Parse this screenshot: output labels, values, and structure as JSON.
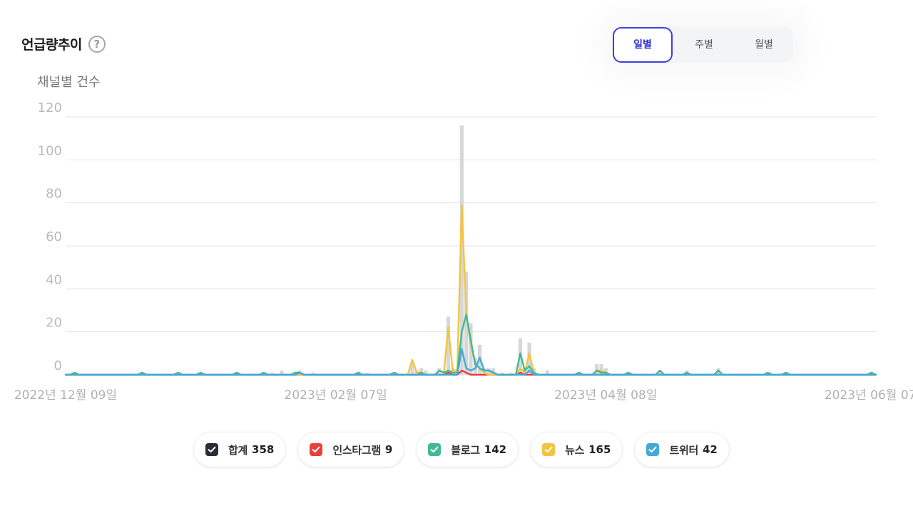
{
  "header": {
    "title": "언급량추이",
    "help_icon": "question-circle-icon"
  },
  "period_toggle": {
    "options": [
      "일별",
      "주별",
      "월별"
    ],
    "selected": "일별",
    "accent": "#3d3ee0"
  },
  "chart_data": {
    "type": "bar+line",
    "ylabel": "채널별 건수",
    "ylim": [
      0,
      120
    ],
    "yticks": [
      0,
      20,
      40,
      60,
      80,
      100,
      120
    ],
    "xlim": [
      "2022-12-09",
      "2023-06-07"
    ],
    "xtick_labels": [
      {
        "date": "2022-12-09",
        "label": "2022년 12월 09일"
      },
      {
        "date": "2023-02-07",
        "label": "2023년 02월 07일"
      },
      {
        "date": "2023-04-08",
        "label": "2023년 04월 08일"
      },
      {
        "date": "2023-06-07",
        "label": "2023년 06월 07일"
      }
    ],
    "grid": true,
    "bar_series": {
      "name": "합계",
      "color": "#d6d7db",
      "points": [
        [
          "2022-12-11",
          1
        ],
        [
          "2022-12-26",
          1
        ],
        [
          "2023-01-03",
          1
        ],
        [
          "2023-01-08",
          1
        ],
        [
          "2023-01-16",
          1
        ],
        [
          "2023-01-22",
          1
        ],
        [
          "2023-01-24",
          1
        ],
        [
          "2023-01-26",
          2
        ],
        [
          "2023-01-29",
          1
        ],
        [
          "2023-01-30",
          2
        ],
        [
          "2023-02-02",
          1
        ],
        [
          "2023-02-12",
          1
        ],
        [
          "2023-02-14",
          1
        ],
        [
          "2023-02-20",
          1
        ],
        [
          "2023-02-24",
          6
        ],
        [
          "2023-02-25",
          2
        ],
        [
          "2023-02-26",
          3
        ],
        [
          "2023-02-27",
          2
        ],
        [
          "2023-03-02",
          3
        ],
        [
          "2023-03-04",
          27
        ],
        [
          "2023-03-05",
          3
        ],
        [
          "2023-03-07",
          116
        ],
        [
          "2023-03-08",
          48
        ],
        [
          "2023-03-09",
          24
        ],
        [
          "2023-03-10",
          8
        ],
        [
          "2023-03-11",
          14
        ],
        [
          "2023-03-12",
          3
        ],
        [
          "2023-03-13",
          3
        ],
        [
          "2023-03-14",
          3
        ],
        [
          "2023-03-16",
          1
        ],
        [
          "2023-03-18",
          1
        ],
        [
          "2023-03-20",
          17
        ],
        [
          "2023-03-21",
          3
        ],
        [
          "2023-03-22",
          15
        ],
        [
          "2023-03-23",
          3
        ],
        [
          "2023-03-26",
          2
        ],
        [
          "2023-04-02",
          1
        ],
        [
          "2023-04-06",
          5
        ],
        [
          "2023-04-07",
          5
        ],
        [
          "2023-04-08",
          3
        ],
        [
          "2023-04-13",
          1
        ],
        [
          "2023-04-20",
          2
        ],
        [
          "2023-04-26",
          2
        ],
        [
          "2023-05-03",
          3
        ],
        [
          "2023-05-14",
          1
        ],
        [
          "2023-05-18",
          1
        ],
        [
          "2023-06-06",
          1
        ]
      ]
    },
    "line_series": [
      {
        "name": "인스타그램",
        "color": "#e8413a",
        "points": [
          [
            "2023-03-03",
            0
          ],
          [
            "2023-03-04",
            1
          ],
          [
            "2023-03-05",
            0
          ],
          [
            "2023-03-06",
            0
          ],
          [
            "2023-03-07",
            2
          ],
          [
            "2023-03-08",
            1
          ],
          [
            "2023-03-09",
            0
          ],
          [
            "2023-03-19",
            0
          ],
          [
            "2023-03-20",
            1
          ],
          [
            "2023-03-21",
            0
          ]
        ]
      },
      {
        "name": "뉴스",
        "color": "#f3c43f",
        "points": [
          [
            "2023-02-23",
            0
          ],
          [
            "2023-02-24",
            7
          ],
          [
            "2023-02-25",
            1
          ],
          [
            "2023-02-26",
            1
          ],
          [
            "2023-02-27",
            0
          ],
          [
            "2023-03-03",
            0
          ],
          [
            "2023-03-04",
            22
          ],
          [
            "2023-03-05",
            2
          ],
          [
            "2023-03-06",
            2
          ],
          [
            "2023-03-07",
            79
          ],
          [
            "2023-03-08",
            28
          ],
          [
            "2023-03-09",
            14
          ],
          [
            "2023-03-10",
            5
          ],
          [
            "2023-03-11",
            3
          ],
          [
            "2023-03-12",
            1
          ],
          [
            "2023-03-13",
            0
          ],
          [
            "2023-03-19",
            0
          ],
          [
            "2023-03-20",
            3
          ],
          [
            "2023-03-21",
            1
          ],
          [
            "2023-03-22",
            10
          ],
          [
            "2023-03-23",
            1
          ],
          [
            "2023-03-24",
            0
          ],
          [
            "2023-04-05",
            0
          ],
          [
            "2023-04-06",
            2
          ],
          [
            "2023-04-07",
            2
          ],
          [
            "2023-04-08",
            1
          ],
          [
            "2023-04-09",
            0
          ]
        ]
      },
      {
        "name": "블로그",
        "color": "#43b894",
        "points": [
          [
            "2022-12-10",
            0
          ],
          [
            "2022-12-11",
            1
          ],
          [
            "2022-12-12",
            0
          ],
          [
            "2022-12-25",
            0
          ],
          [
            "2022-12-26",
            1
          ],
          [
            "2022-12-27",
            0
          ],
          [
            "2023-01-02",
            0
          ],
          [
            "2023-01-03",
            1
          ],
          [
            "2023-01-04",
            0
          ],
          [
            "2023-01-07",
            0
          ],
          [
            "2023-01-08",
            1
          ],
          [
            "2023-01-09",
            0
          ],
          [
            "2023-01-15",
            0
          ],
          [
            "2023-01-16",
            1
          ],
          [
            "2023-01-17",
            0
          ],
          [
            "2023-01-21",
            0
          ],
          [
            "2023-01-22",
            1
          ],
          [
            "2023-01-23",
            0
          ],
          [
            "2023-01-28",
            0
          ],
          [
            "2023-01-29",
            1
          ],
          [
            "2023-01-30",
            1
          ],
          [
            "2023-01-31",
            0
          ],
          [
            "2023-02-11",
            0
          ],
          [
            "2023-02-12",
            1
          ],
          [
            "2023-02-13",
            0
          ],
          [
            "2023-02-19",
            0
          ],
          [
            "2023-02-20",
            1
          ],
          [
            "2023-02-21",
            0
          ],
          [
            "2023-02-25",
            0
          ],
          [
            "2023-02-26",
            1
          ],
          [
            "2023-02-27",
            0
          ],
          [
            "2023-03-01",
            0
          ],
          [
            "2023-03-02",
            2
          ],
          [
            "2023-03-03",
            1
          ],
          [
            "2023-03-04",
            2
          ],
          [
            "2023-03-05",
            1
          ],
          [
            "2023-03-06",
            1
          ],
          [
            "2023-03-07",
            20
          ],
          [
            "2023-03-08",
            28
          ],
          [
            "2023-03-09",
            16
          ],
          [
            "2023-03-10",
            5
          ],
          [
            "2023-03-11",
            3
          ],
          [
            "2023-03-12",
            2
          ],
          [
            "2023-03-13",
            2
          ],
          [
            "2023-03-14",
            1
          ],
          [
            "2023-03-15",
            0
          ],
          [
            "2023-03-19",
            0
          ],
          [
            "2023-03-20",
            10
          ],
          [
            "2023-03-21",
            2
          ],
          [
            "2023-03-22",
            4
          ],
          [
            "2023-03-23",
            1
          ],
          [
            "2023-03-24",
            0
          ],
          [
            "2023-04-01",
            0
          ],
          [
            "2023-04-02",
            1
          ],
          [
            "2023-04-03",
            0
          ],
          [
            "2023-04-05",
            0
          ],
          [
            "2023-04-06",
            2
          ],
          [
            "2023-04-07",
            1
          ],
          [
            "2023-04-08",
            1
          ],
          [
            "2023-04-09",
            0
          ],
          [
            "2023-04-12",
            0
          ],
          [
            "2023-04-13",
            1
          ],
          [
            "2023-04-14",
            0
          ],
          [
            "2023-04-19",
            0
          ],
          [
            "2023-04-20",
            2
          ],
          [
            "2023-04-21",
            0
          ],
          [
            "2023-04-25",
            0
          ],
          [
            "2023-04-26",
            1
          ],
          [
            "2023-04-27",
            0
          ],
          [
            "2023-05-02",
            0
          ],
          [
            "2023-05-03",
            2
          ],
          [
            "2023-05-04",
            0
          ],
          [
            "2023-05-13",
            0
          ],
          [
            "2023-05-14",
            1
          ],
          [
            "2023-05-15",
            0
          ],
          [
            "2023-05-17",
            0
          ],
          [
            "2023-05-18",
            1
          ],
          [
            "2023-05-19",
            0
          ],
          [
            "2023-06-05",
            0
          ],
          [
            "2023-06-06",
            1
          ],
          [
            "2023-06-07",
            0
          ]
        ]
      },
      {
        "name": "트위터",
        "color": "#45a9d6",
        "points": [
          [
            "2023-01-29",
            0
          ],
          [
            "2023-01-30",
            1
          ],
          [
            "2023-01-31",
            0
          ],
          [
            "2023-03-06",
            0
          ],
          [
            "2023-03-07",
            12
          ],
          [
            "2023-03-08",
            3
          ],
          [
            "2023-03-09",
            2
          ],
          [
            "2023-03-10",
            3
          ],
          [
            "2023-03-11",
            8
          ],
          [
            "2023-03-12",
            2
          ],
          [
            "2023-03-13",
            2
          ],
          [
            "2023-03-14",
            1
          ],
          [
            "2023-03-15",
            0
          ],
          [
            "2023-03-21",
            0
          ],
          [
            "2023-03-22",
            2
          ],
          [
            "2023-03-23",
            0
          ]
        ]
      }
    ]
  },
  "legend": [
    {
      "label": "합계",
      "count": "358",
      "color": "#2a2d38"
    },
    {
      "label": "인스타그램",
      "count": "9",
      "color": "#e8413a"
    },
    {
      "label": "블로그",
      "count": "142",
      "color": "#43b894"
    },
    {
      "label": "뉴스",
      "count": "165",
      "color": "#f3c43f"
    },
    {
      "label": "트위터",
      "count": "42",
      "color": "#45a9d6"
    }
  ]
}
